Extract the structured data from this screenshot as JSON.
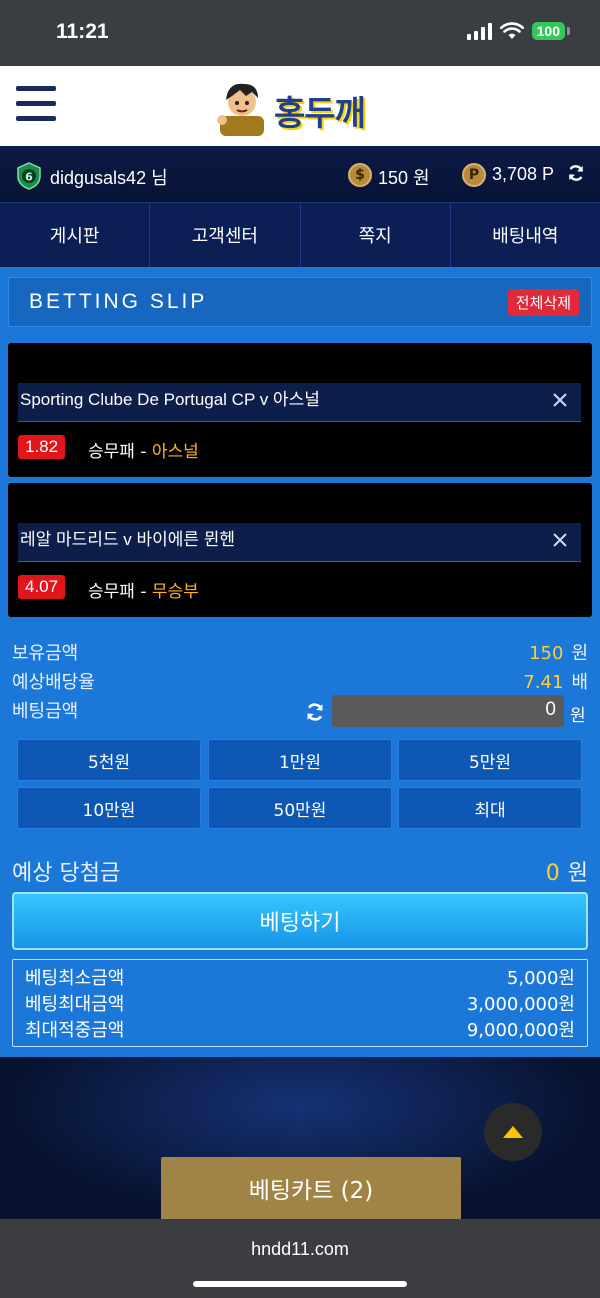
{
  "status_bar": {
    "time": "11:21",
    "battery": "100"
  },
  "header": {
    "logo_text": "홍두깨"
  },
  "user": {
    "level": "6",
    "username": "didgusals42 님",
    "cash_icon": "$",
    "cash": "150 원",
    "point_icon": "P",
    "points": "3,708 P"
  },
  "nav": {
    "items": [
      {
        "label": "게시판"
      },
      {
        "label": "고객센터"
      },
      {
        "label": "쪽지"
      },
      {
        "label": "배팅내역"
      }
    ]
  },
  "slip": {
    "title": "BETTING SLIP",
    "clear_all": "전체삭제",
    "bets": [
      {
        "match": "Sporting Clube De Portugal CP v 아스널",
        "odds": "1.82",
        "market": "승무패",
        "separator": " - ",
        "pick": "아스널"
      },
      {
        "match": "레알 마드리드 v 바이에른 뮌헨",
        "odds": "4.07",
        "market": "승무패",
        "separator": " - ",
        "pick": "무승부"
      }
    ]
  },
  "summary": {
    "balance_label": "보유금액",
    "balance_value": "150",
    "balance_unit": "원",
    "odds_label": "예상배당율",
    "odds_value": "7.41",
    "odds_unit": "배",
    "stake_label": "베팅금액",
    "stake_value": "0",
    "stake_unit": "원"
  },
  "amount_buttons": [
    {
      "label": "5천원"
    },
    {
      "label": "1만원"
    },
    {
      "label": "5만원"
    },
    {
      "label": "10만원"
    },
    {
      "label": "50만원"
    },
    {
      "label": "최대"
    }
  ],
  "winnings": {
    "label": "예상 당첨금",
    "value": "0",
    "unit": "원"
  },
  "bet_button": "베팅하기",
  "limits": [
    {
      "label": "베팅최소금액",
      "value": "5,000원"
    },
    {
      "label": "베팅최대금액",
      "value": "3,000,000원"
    },
    {
      "label": "최대적중금액",
      "value": "9,000,000원"
    }
  ],
  "bet_cart": "베팅카트 (2)",
  "browser": {
    "url": "hndd11.com"
  },
  "colors": {
    "accent": "#1b78d8",
    "odds_badge": "#e3151c",
    "pick": "#ffb21a",
    "cart": "#a08447"
  }
}
